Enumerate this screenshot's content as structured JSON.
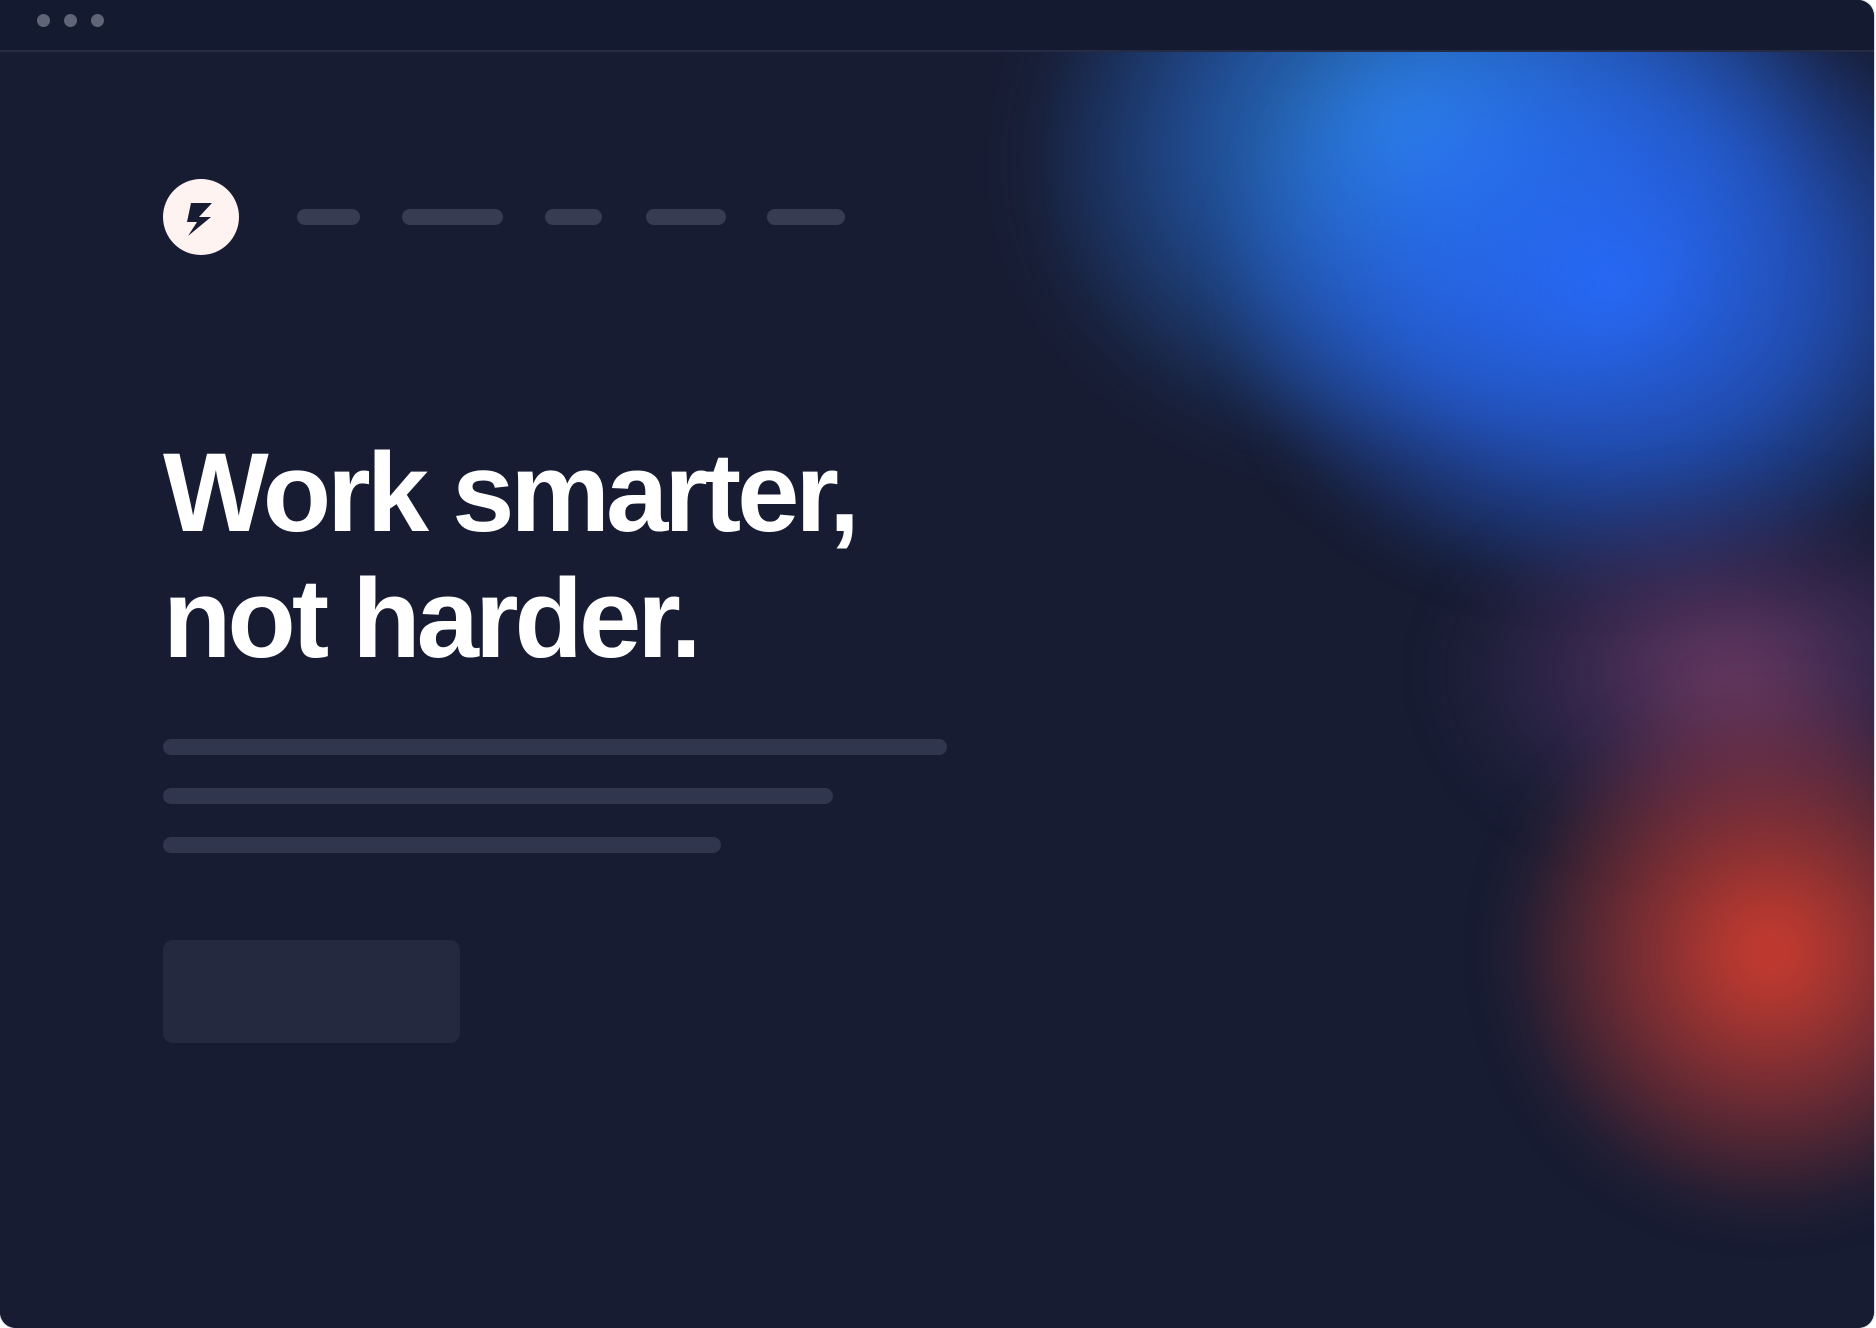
{
  "window": {
    "title_bar_controls": [
      "window-dot",
      "window-dot",
      "window-dot"
    ]
  },
  "header": {
    "logo_icon": "lightning-bolt-icon",
    "nav_items": [
      {
        "label": ""
      },
      {
        "label": ""
      },
      {
        "label": ""
      },
      {
        "label": ""
      },
      {
        "label": ""
      }
    ]
  },
  "hero": {
    "headline_line_1": "Work smarter,",
    "headline_line_2": "not harder.",
    "body_lines": [
      "",
      "",
      ""
    ],
    "cta_label": ""
  },
  "theme": {
    "background": "#171c33",
    "headline_color": "#ffffff",
    "placeholder_color": "#373c53",
    "accent_blue": "#286cff",
    "accent_cyan": "#2f93f0",
    "accent_red": "#db3f2e",
    "logo_background": "#fff3f2"
  }
}
